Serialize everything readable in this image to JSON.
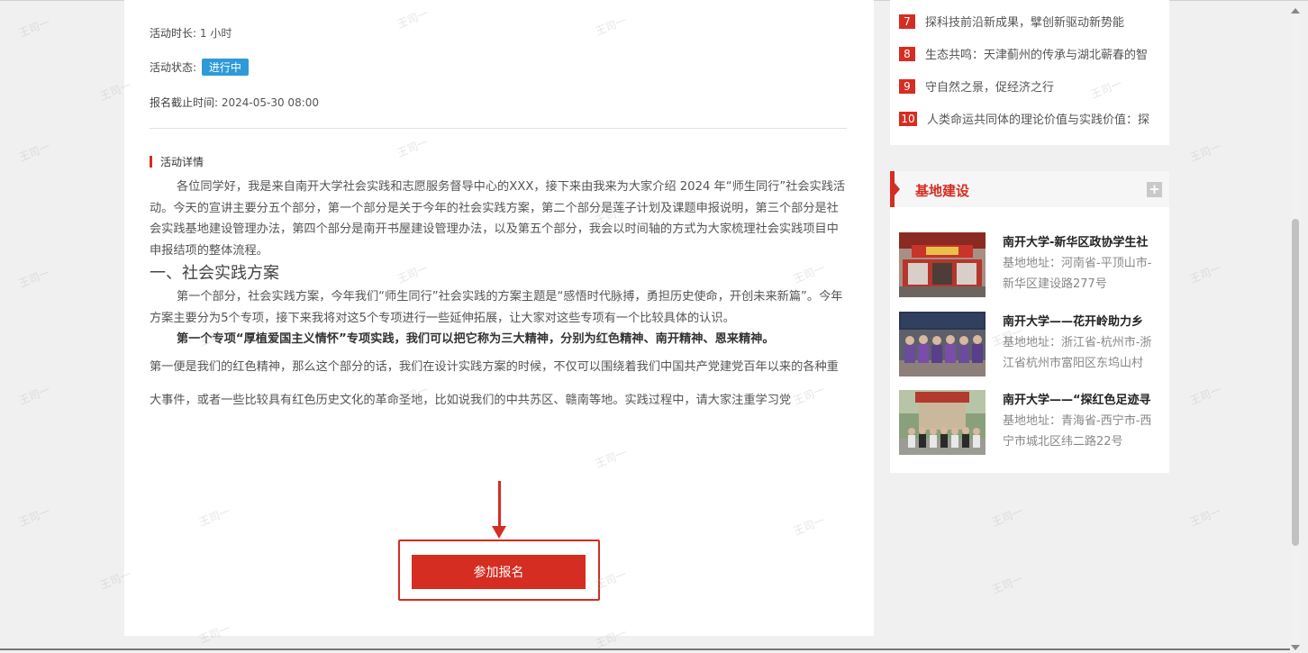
{
  "activity": {
    "duration_label": "活动时长:",
    "duration_value": "1 小时",
    "status_label": "活动状态:",
    "status_value": "进行中",
    "deadline_label": "报名截止时间:",
    "deadline_value": "2024-05-30 08:00",
    "details_heading": "活动详情",
    "para1": "各位同学好，我是来自南开大学社会实践和志愿服务督导中心的XXX，接下来由我来为大家介绍 2024 年“师生同行”社会实践活动。今天的宣讲主要分五个部分，第一个部分是关于今年的社会实践方案，第二个部分是莲子计划及课题申报说明，第三个部分是社会实践基地建设管理办法，第四个部分是南开书屋建设管理办法，以及第五个部分，我会以时间轴的方式为大家梳理社会实践项目中申报结项的整体流程。",
    "heading1": "一、社会实践方案",
    "para2": "第一个部分，社会实践方案，今年我们“师生同行”社会实践的方案主题是“感悟时代脉搏，勇担历史使命，开创未来新篇”。今年方案主要分为5个专项，接下来我将对这5个专项进行一些延伸拓展，让大家对这些专项有一个比较具体的认识。",
    "para3": "第一个专项“厚植爱国主义情怀”专项实践，我们可以把它称为三大精神，分别为红色精神、南开精神、恩来精神。",
    "para4": "第一便是我们的红色精神，那么这个部分的话，我们在设计实践方案的时候，不仅可以围绕着我们中国共产党建党百年以来的各种重大事件，或者一些比较具有红色历史文化的革命圣地，比如说我们的中共苏区、赣南等地。实践过程中，请大家注重学习党",
    "join_button": "参加报名"
  },
  "ranking": [
    {
      "num": "7",
      "text": "探科技前沿新成果，擘创新驱动新势能"
    },
    {
      "num": "8",
      "text": "生态共鸣：天津蓟州的传承与湖北蕲春的智"
    },
    {
      "num": "9",
      "text": "守自然之景，促经济之行"
    },
    {
      "num": "10",
      "text": "人类命运共同体的理论价值与实践价值：探"
    }
  ],
  "base_section": {
    "title": "基地建设",
    "items": [
      {
        "name": "南开大学-新华区政协学生社",
        "address": "基地地址：河南省-平顶山市-新华区建设路277号"
      },
      {
        "name": "南开大学——花开岭助力乡",
        "address": "基地地址：浙江省-杭州市-浙江省杭州市富阳区东坞山村"
      },
      {
        "name": "南开大学——“探红色足迹寻",
        "address": "基地地址：青海省-西宁市-西宁市城北区纬二路22号"
      }
    ]
  },
  "watermark_text": "王司一",
  "colors": {
    "accent": "#d52d22",
    "status_badge": "#2e9ad8"
  }
}
